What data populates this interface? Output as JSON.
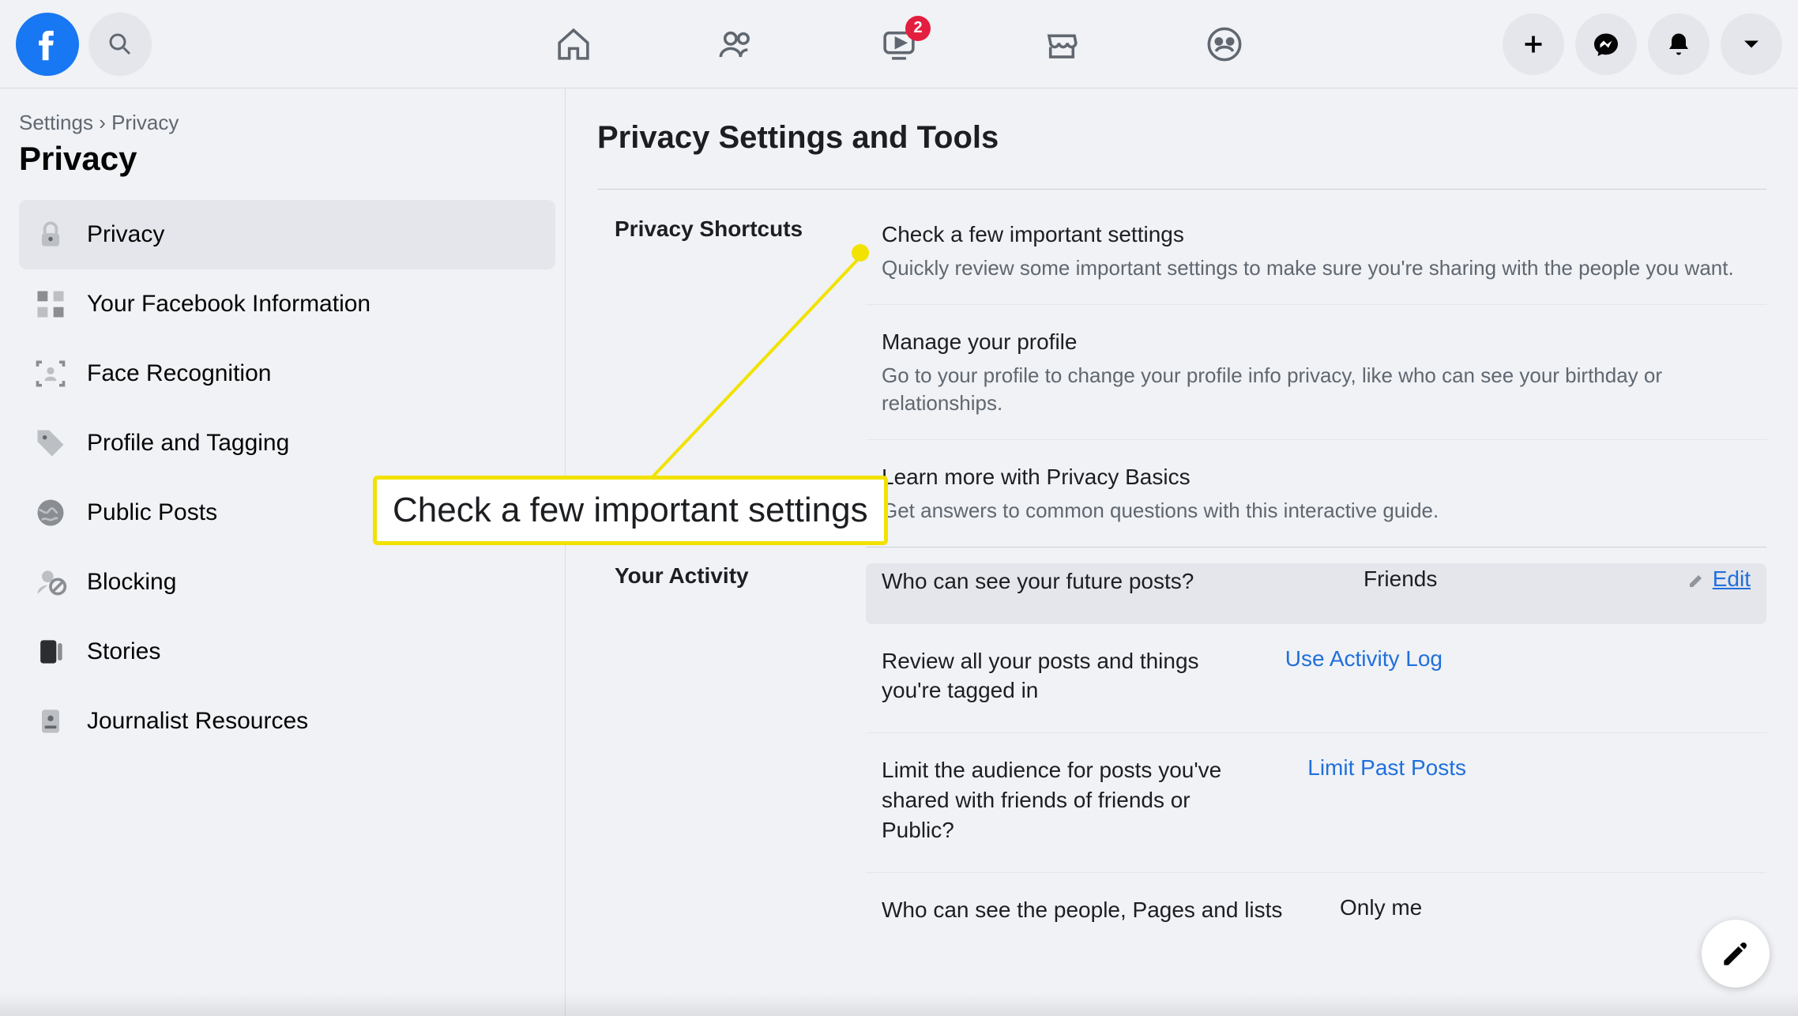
{
  "topbar": {
    "watch_badge": "2"
  },
  "breadcrumb": {
    "root": "Settings",
    "sep": "›",
    "leaf": "Privacy"
  },
  "sidebar": {
    "title": "Privacy",
    "items": [
      {
        "label": "Privacy"
      },
      {
        "label": "Your Facebook Information"
      },
      {
        "label": "Face Recognition"
      },
      {
        "label": "Profile and Tagging"
      },
      {
        "label": "Public Posts"
      },
      {
        "label": "Blocking"
      },
      {
        "label": "Stories"
      },
      {
        "label": "Journalist Resources"
      }
    ]
  },
  "main": {
    "title": "Privacy Settings and Tools",
    "sections": [
      {
        "label": "Privacy Shortcuts",
        "rows": [
          {
            "title": "Check a few important settings",
            "sub": "Quickly review some important settings to make sure you're sharing with the people you want."
          },
          {
            "title": "Manage your profile",
            "sub": "Go to your profile to change your profile info privacy, like who can see your birthday or relationships."
          },
          {
            "title": "Learn more with Privacy Basics",
            "sub": "Get answers to common questions with this interactive guide."
          }
        ]
      },
      {
        "label": "Your Activity",
        "rows": [
          {
            "title": "Who can see your future posts?",
            "value": "Friends",
            "action": "Edit",
            "highlight": true
          },
          {
            "title": "Review all your posts and things you're tagged in",
            "action": "Use Activity Log"
          },
          {
            "title": "Limit the audience for posts you've shared with friends of friends or Public?",
            "action": "Limit Past Posts"
          },
          {
            "title": "Who can see the people, Pages and lists",
            "value": "Only me"
          }
        ]
      }
    ]
  },
  "callout": {
    "text": "Check a few important settings"
  }
}
